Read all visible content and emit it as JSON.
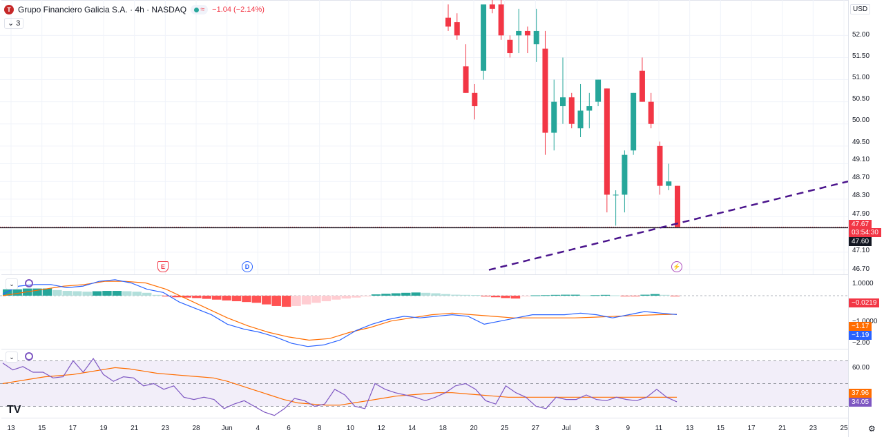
{
  "header": {
    "logo_letter": "T",
    "title": "Grupo Financiero Galicia S.A. · 4h · NASDAQ",
    "status_symbol": "≈",
    "change": "−1.04 (−2.14%)",
    "legend_count": "3",
    "currency": "USD",
    "collapse_icon": "chevron-down-icon",
    "refresh_icon": "refresh-icon"
  },
  "price_axis": {
    "labels": [
      "52.00",
      "51.50",
      "51.00",
      "50.50",
      "50.00",
      "49.50",
      "49.10",
      "48.70",
      "48.30",
      "47.90",
      "47.10",
      "46.70"
    ],
    "last_price": "47.67",
    "countdown": "03:54:30",
    "crosshair_price": "47.60"
  },
  "macd": {
    "labels": [
      "1.0000",
      "−1.0000",
      "−2.00"
    ],
    "histogram_value": "−0.0219",
    "signal_value": "−1.17",
    "macd_value": "−1.19"
  },
  "rsi": {
    "labels": [
      "60.00"
    ],
    "ma_value": "37.96",
    "rsi_value": "34.05"
  },
  "date_axis": [
    "13",
    "15",
    "17",
    "19",
    "21",
    "23",
    "28",
    "Jun",
    "4",
    "6",
    "8",
    "10",
    "12",
    "14",
    "18",
    "20",
    "25",
    "27",
    "Jul",
    "3",
    "9",
    "11",
    "13",
    "15",
    "17",
    "21",
    "23",
    "25"
  ],
  "events": [
    {
      "label": "E",
      "name": "earnings-event-icon"
    },
    {
      "label": "D",
      "name": "dividend-event-icon"
    },
    {
      "label": "⚡",
      "name": "split-event-icon"
    }
  ],
  "brand": "TV",
  "colors": {
    "up": "#26a69a",
    "down": "#f23645",
    "macd_line": "#2962ff",
    "signal_line": "#ff6d00",
    "rsi_line": "#7e57c2",
    "trendline": "#4a148c"
  },
  "chart_data": {
    "type": "candlestick",
    "title": "Grupo Financiero Galicia S.A. · 4h · NASDAQ",
    "candles": [
      {
        "o": 52.4,
        "h": 52.7,
        "l": 52.1,
        "c": 52.2
      },
      {
        "o": 52.3,
        "h": 52.5,
        "l": 51.9,
        "c": 52.0
      },
      {
        "o": 51.3,
        "h": 51.8,
        "l": 50.7,
        "c": 50.7
      },
      {
        "o": 50.7,
        "h": 50.9,
        "l": 50.1,
        "c": 50.4
      },
      {
        "o": 51.2,
        "h": 52.6,
        "l": 51.0,
        "c": 52.7
      },
      {
        "o": 52.7,
        "h": 52.9,
        "l": 52.5,
        "c": 52.6
      },
      {
        "o": 52.7,
        "h": 52.8,
        "l": 51.9,
        "c": 52.0
      },
      {
        "o": 51.9,
        "h": 52.0,
        "l": 51.5,
        "c": 51.6
      },
      {
        "o": 52.0,
        "h": 52.6,
        "l": 51.6,
        "c": 52.1
      },
      {
        "o": 52.1,
        "h": 52.2,
        "l": 51.6,
        "c": 52.0
      },
      {
        "o": 51.8,
        "h": 52.6,
        "l": 51.4,
        "c": 52.1
      },
      {
        "o": 51.7,
        "h": 52.1,
        "l": 49.3,
        "c": 49.8
      },
      {
        "o": 49.8,
        "h": 51.0,
        "l": 49.4,
        "c": 50.5
      },
      {
        "o": 50.4,
        "h": 51.5,
        "l": 50.0,
        "c": 50.6
      },
      {
        "o": 50.6,
        "h": 50.7,
        "l": 49.9,
        "c": 50.0
      },
      {
        "o": 49.9,
        "h": 50.9,
        "l": 49.7,
        "c": 50.3
      },
      {
        "o": 50.3,
        "h": 50.7,
        "l": 49.9,
        "c": 50.4
      },
      {
        "o": 50.5,
        "h": 51.0,
        "l": 50.4,
        "c": 51.0
      },
      {
        "o": 50.8,
        "h": 50.8,
        "l": 48.0,
        "c": 48.4
      },
      {
        "o": 48.4,
        "h": 48.5,
        "l": 47.7,
        "c": 48.4
      },
      {
        "o": 48.4,
        "h": 49.4,
        "l": 48.0,
        "c": 49.3
      },
      {
        "o": 49.4,
        "h": 50.7,
        "l": 49.3,
        "c": 50.7
      },
      {
        "o": 51.2,
        "h": 51.5,
        "l": 50.5,
        "c": 50.5
      },
      {
        "o": 50.5,
        "h": 50.7,
        "l": 49.9,
        "c": 50.0
      },
      {
        "o": 49.5,
        "h": 49.6,
        "l": 48.4,
        "c": 48.6
      },
      {
        "o": 48.6,
        "h": 49.1,
        "l": 48.5,
        "c": 48.7
      },
      {
        "o": 48.6,
        "h": 48.6,
        "l": 47.7,
        "c": 47.67
      }
    ],
    "last_price": 47.67,
    "ylim": [
      46.6,
      52.8
    ],
    "trendline": {
      "start_price": 46.7,
      "end_price": 48.7
    },
    "macd": {
      "histogram": [
        0.4,
        0.4,
        0.45,
        0.45,
        0.45,
        0.35,
        0.3,
        0.28,
        0.25,
        0.28,
        0.3,
        0.3,
        0.28,
        0.25,
        0.18,
        0.05,
        -0.05,
        -0.1,
        -0.12,
        -0.15,
        -0.2,
        -0.25,
        -0.3,
        -0.35,
        -0.4,
        -0.45,
        -0.55,
        -0.65,
        -0.7,
        -0.65,
        -0.55,
        -0.45,
        -0.35,
        -0.25,
        -0.18,
        -0.12,
        -0.05,
        0.08,
        0.12,
        0.15,
        0.18,
        0.2,
        0.18,
        0.15,
        0.1,
        0.06,
        0.05,
        0.04,
        -0.05,
        -0.1,
        -0.15,
        -0.18,
        -0.05,
        0.02,
        0.03,
        0.05,
        0.06,
        0.06,
        0.02,
        0.03,
        0.05,
        0.02,
        -0.02,
        -0.03,
        0.06,
        0.1,
        0.05,
        -0.02
      ],
      "macd_line": [
        0.1,
        0.6,
        0.7,
        0.7,
        0.5,
        0.6,
        0.9,
        1.0,
        0.8,
        0.4,
        0.2,
        -0.4,
        -0.8,
        -1.2,
        -1.8,
        -2.1,
        -2.3,
        -2.6,
        -3.0,
        -3.2,
        -3.1,
        -2.8,
        -2.2,
        -1.8,
        -1.5,
        -1.3,
        -1.4,
        -1.3,
        -1.2,
        -1.3,
        -1.8,
        -1.6,
        -1.4,
        -1.2,
        -1.2,
        -1.2,
        -1.1,
        -1.2,
        -1.4,
        -1.2,
        -1.0,
        -1.1,
        -1.19
      ],
      "signal_line": [
        0.0,
        0.2,
        0.4,
        0.6,
        0.7,
        0.9,
        0.9,
        0.8,
        0.4,
        -0.2,
        -0.8,
        -1.4,
        -1.9,
        -2.3,
        -2.6,
        -2.8,
        -2.7,
        -2.3,
        -2.0,
        -1.6,
        -1.4,
        -1.2,
        -1.1,
        -1.2,
        -1.3,
        -1.4,
        -1.4,
        -1.4,
        -1.4,
        -1.35,
        -1.3,
        -1.25,
        -1.2,
        -1.17
      ]
    },
    "rsi": {
      "ylim": [
        20,
        80
      ],
      "bands": [
        70,
        50,
        30
      ],
      "rsi_line": [
        68,
        62,
        65,
        60,
        60,
        55,
        56,
        70,
        60,
        72,
        58,
        52,
        56,
        55,
        48,
        50,
        45,
        48,
        38,
        36,
        38,
        36,
        28,
        32,
        35,
        30,
        25,
        22,
        28,
        37,
        35,
        30,
        32,
        45,
        40,
        30,
        28,
        50,
        45,
        42,
        40,
        38,
        35,
        38,
        42,
        48,
        50,
        45,
        35,
        32,
        48,
        42,
        38,
        30,
        28,
        38,
        36,
        36,
        40,
        36,
        35,
        38,
        36,
        35,
        38,
        45,
        38,
        34
      ],
      "ma_line": [
        50,
        52,
        54,
        56,
        57,
        58,
        60,
        62,
        64,
        63,
        61,
        59,
        58,
        57,
        56,
        55,
        52,
        48,
        44,
        40,
        36,
        33,
        32,
        31,
        31,
        33,
        35,
        37,
        39,
        40,
        41,
        42,
        42,
        41,
        40,
        39,
        38,
        38,
        38,
        38,
        38,
        38,
        38,
        38,
        38,
        38,
        38,
        38,
        38
      ]
    }
  }
}
